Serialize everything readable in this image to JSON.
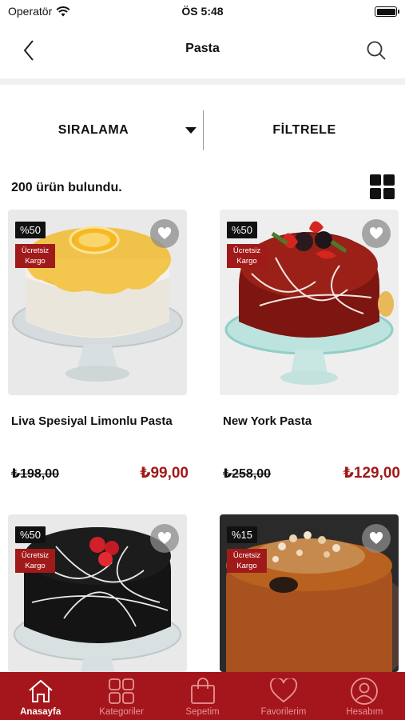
{
  "status": {
    "carrier": "Operatör",
    "time": "ÖS 5:48"
  },
  "nav": {
    "title": "Pasta"
  },
  "toolbar": {
    "sort_label": "SIRALAMA",
    "filter_label": "FİLTRELE"
  },
  "results": {
    "count_text": "200  ürün bulundu."
  },
  "products": [
    {
      "name": "Liva Spesiyal Limonlu Pasta",
      "discount": "%50",
      "shipping": "Ücretsiz Kargo",
      "old_price": "₺198,00",
      "new_price": "₺99,00"
    },
    {
      "name": "New York Pasta",
      "discount": "%50",
      "shipping": "Ücretsiz Kargo",
      "old_price": "₺258,00",
      "new_price": "₺129,00"
    },
    {
      "discount": "%50",
      "shipping": "Ücretsiz Kargo"
    },
    {
      "discount": "%15",
      "shipping": "Ücretsiz Kargo"
    }
  ],
  "tabs": [
    {
      "label": "Anasayfa",
      "icon": "home-icon",
      "active": true
    },
    {
      "label": "Kategoriler",
      "icon": "categories-icon"
    },
    {
      "label": "Sepetim",
      "icon": "bag-icon"
    },
    {
      "label": "Favorilerim",
      "icon": "heart-icon"
    },
    {
      "label": "Hesabım",
      "icon": "account-icon"
    }
  ],
  "colors": {
    "accent": "#a5161c",
    "price": "#a11a1a"
  }
}
